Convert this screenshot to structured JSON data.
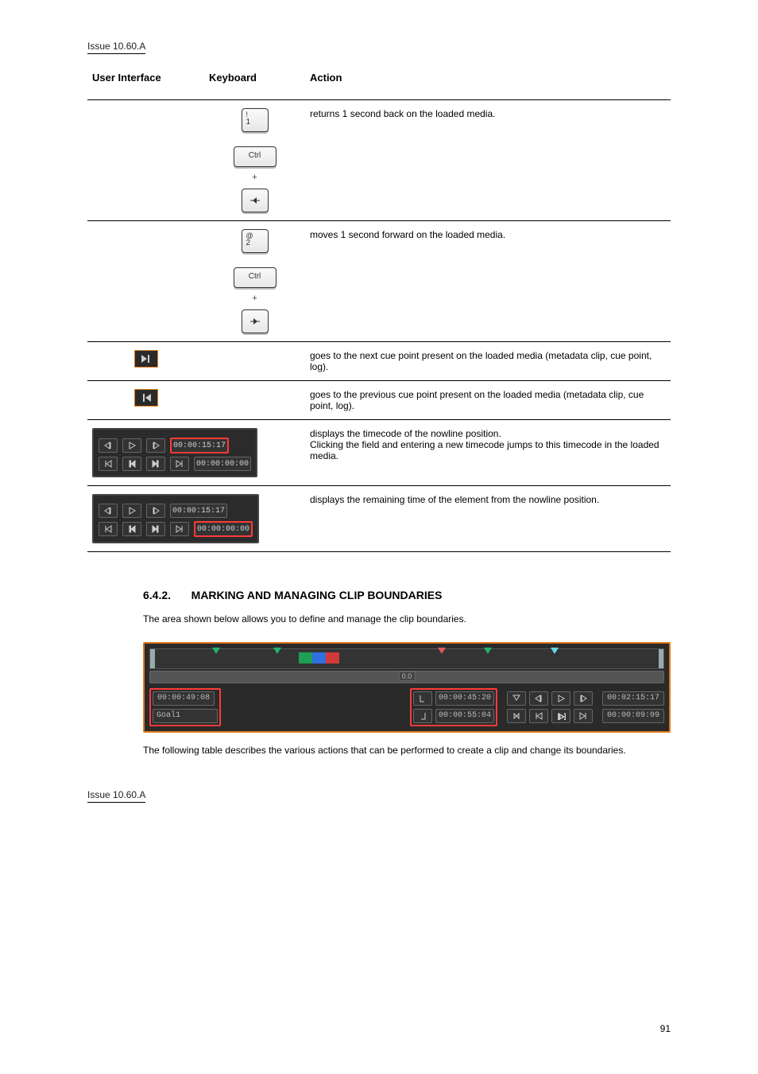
{
  "issue_top": "Issue 10.60.A",
  "issue_bottom": "Issue 10.60.A",
  "page_num": "91",
  "table": {
    "headers": [
      "User Interface",
      "Keyboard",
      "Action"
    ],
    "rows": [
      {
        "key_alt": "Ctrl",
        "key_1_top": "!",
        "key_1_bottom": "1",
        "action": "returns 1 second back on the loaded media."
      },
      {
        "key_alt": "Ctrl",
        "key_2_top": "@",
        "key_2_bottom": "2",
        "action": "moves 1 second forward on the loaded media."
      },
      {
        "action_next": "goes to the next cue point present on the loaded media (metadata clip, cue point, log)."
      },
      {
        "action_prev": "goes to the previous cue point present on the loaded media (metadata clip, cue point, log)."
      },
      {
        "tc1": "00:00:15:17",
        "tc2": "00:00:00:00",
        "action_tcnav": "displays the timecode of the nowline position.\nClicking the field and entering a new timecode jumps to this timecode in the loaded media."
      },
      {
        "tc1": "00:00:15:17",
        "tc2": "00:00:00:00",
        "action_tcdur": "displays the remaining time of the element from the nowline position."
      }
    ]
  },
  "section": {
    "number": "6.4.2.",
    "title": "MARKING AND MANAGING CLIP BOUNDARIES",
    "intro": "The area shown below allows you to define and manage the clip boundaries.",
    "outro": "The following table describes the various actions that can be performed to create a clip and change its boundaries."
  },
  "widebar": {
    "tc_left": "00:00:49:08",
    "clip_name": "Goal1",
    "tc_in": "00:00:45:20",
    "tc_out": "00:00:55:04",
    "tc_right_top": "00:02:15:17",
    "tc_right_bottom": "00:00:09:09",
    "scrub_label": "0.0"
  }
}
